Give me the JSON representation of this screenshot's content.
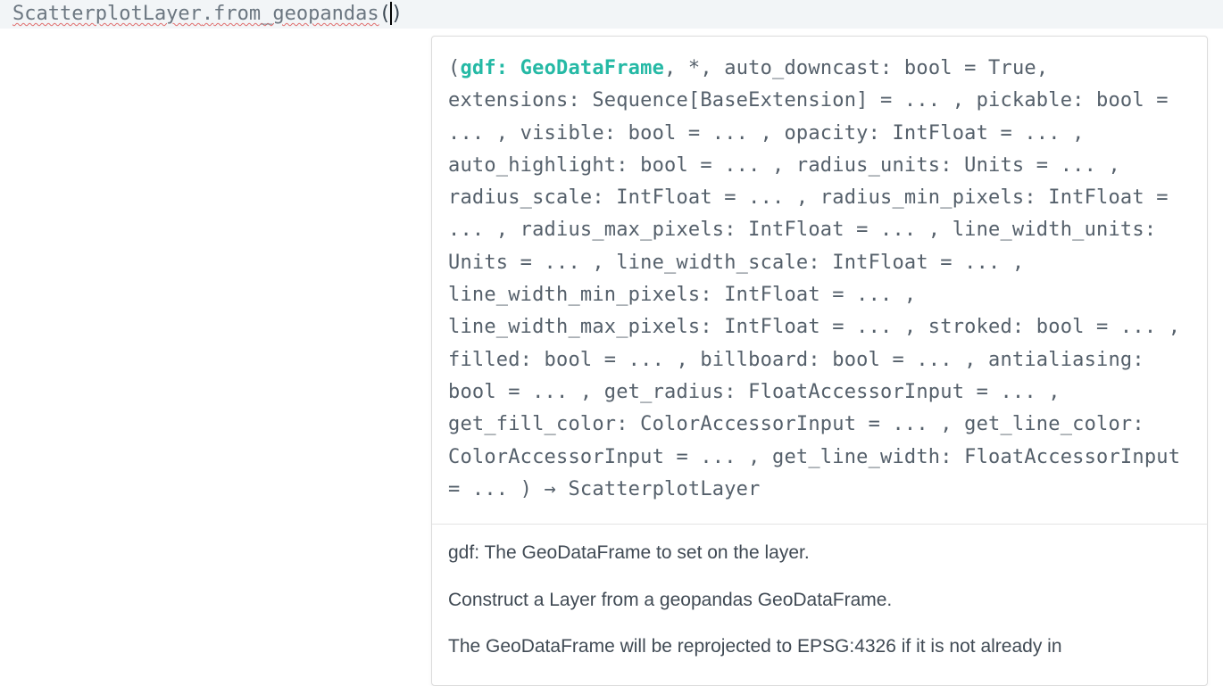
{
  "code": {
    "class_name": "ScatterplotLayer",
    "dot": ".",
    "method": "from_geopandas",
    "paren_open": "(",
    "paren_close": ")"
  },
  "tooltip": {
    "sig": {
      "open": "(",
      "current_param": "gdf: GeoDataFrame",
      "rest": ", *, auto_downcast: bool = True, extensions: Sequence[BaseExtension] = ... , pickable: bool = ... , visible: bool = ... , opacity: IntFloat = ... , auto_highlight: bool = ... , radius_units: Units = ... , radius_scale: IntFloat = ... , radius_min_pixels: IntFloat = ... , radius_max_pixels: IntFloat = ... , line_width_units: Units = ... , line_width_scale: IntFloat = ... , line_width_min_pixels: IntFloat = ... , line_width_max_pixels: IntFloat = ... , stroked: bool = ... , filled: bool = ... , billboard: bool = ... , antialiasing: bool = ... , get_radius: FloatAccessorInput = ... , get_fill_color: ColorAccessorInput = ... , get_line_color: ColorAccessorInput = ... , get_line_width: FloatAccessorInput = ... ) → ScatterplotLayer"
    },
    "doc": {
      "p1": "gdf: The GeoDataFrame to set on the layer.",
      "p2": "Construct a Layer from a geopandas GeoDataFrame.",
      "p3": "The GeoDataFrame will be reprojected to EPSG:4326 if it is not already in"
    }
  }
}
